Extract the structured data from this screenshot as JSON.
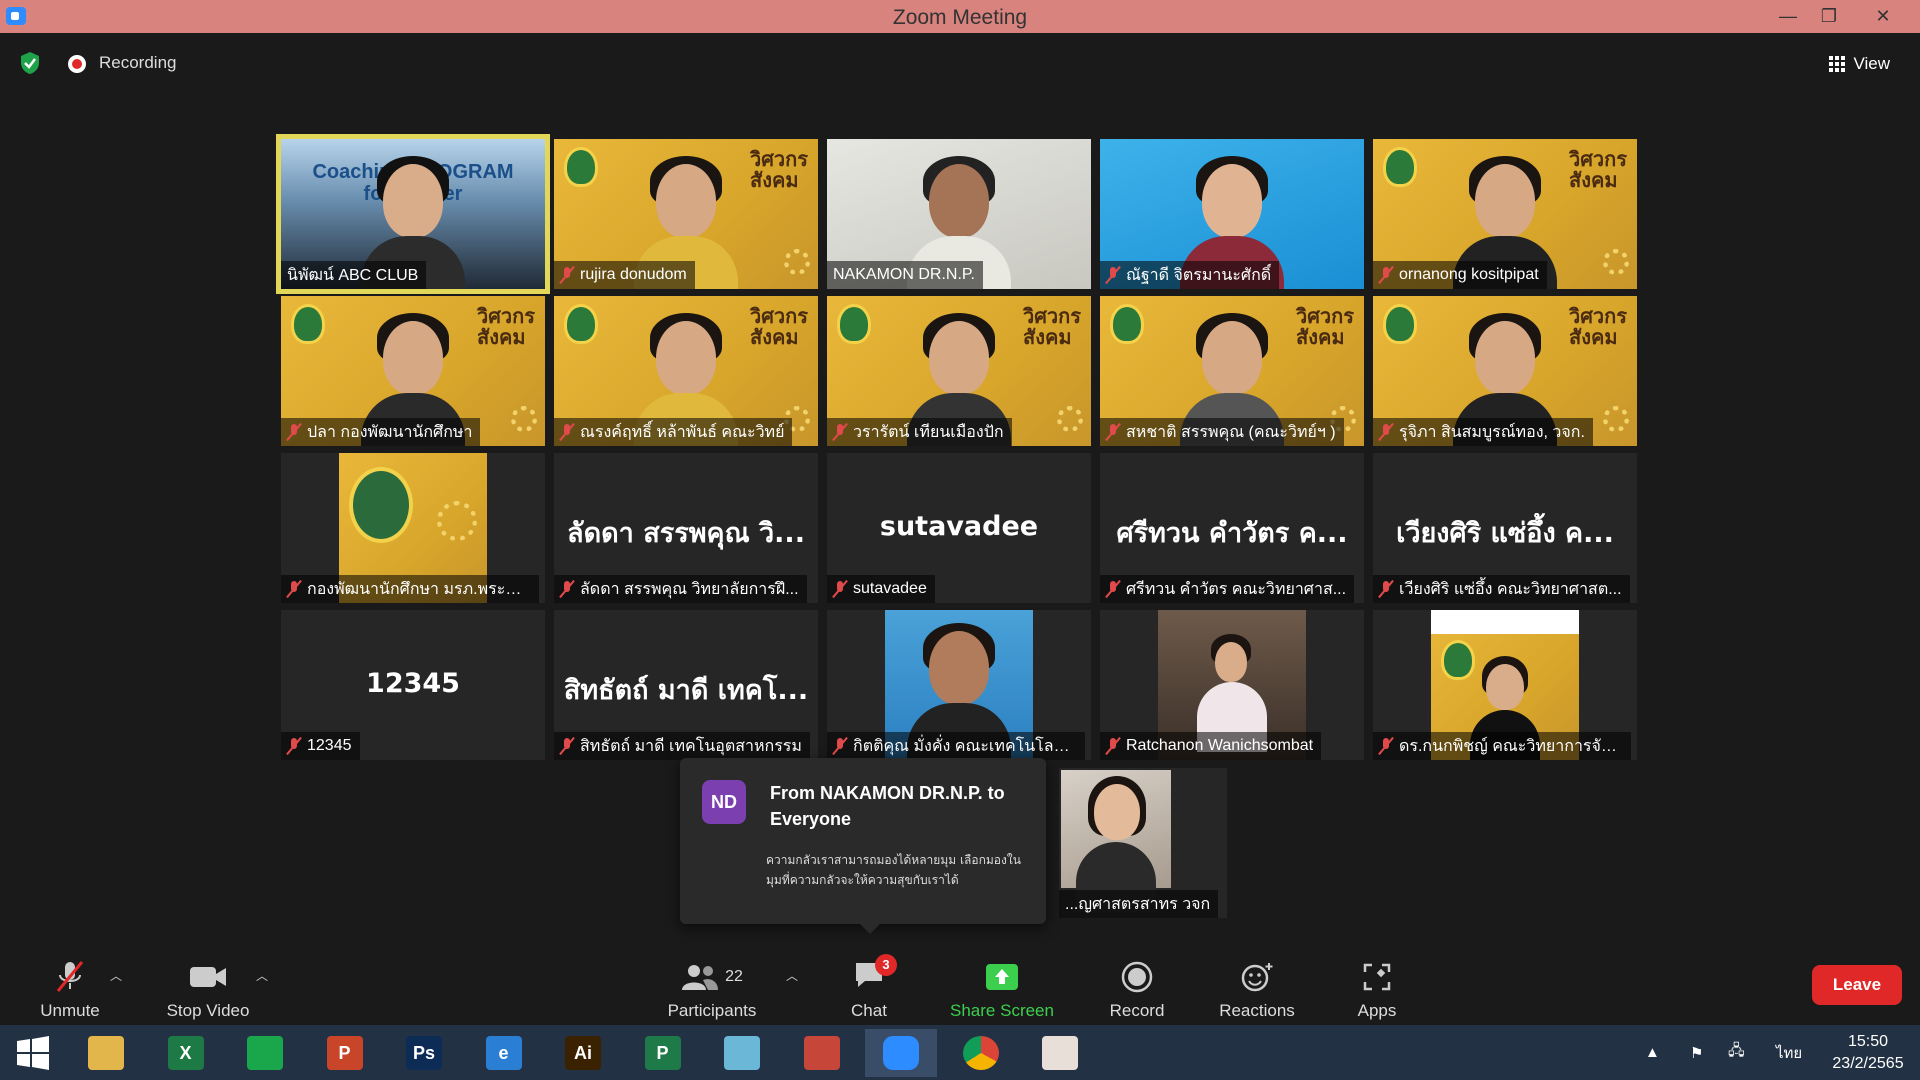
{
  "window": {
    "title": "Zoom Meeting",
    "minimize": "—",
    "restore": "❐",
    "close": "✕"
  },
  "topbar": {
    "recording_label": "Recording",
    "view_label": "View"
  },
  "participants_grid": [
    {
      "name": "นิพัฒน์ ABC CLUB",
      "bg": "coach",
      "active": true,
      "muted": false,
      "overlay_text": "Coaching PROGRAM for Trainer"
    },
    {
      "name": "rujira donudom",
      "bg": "yellow",
      "muted": true
    },
    {
      "name": "NAKAMON DR.N.P.",
      "bg": "white",
      "muted": false
    },
    {
      "name": "ณัฐาดี จิตรมานะศักดิ์",
      "bg": "blue",
      "muted": true
    },
    {
      "name": "ornanong kositpipat",
      "bg": "yellow",
      "muted": true
    },
    {
      "name": "ปลา กองพัฒนานักศึกษา",
      "bg": "yellow",
      "muted": true
    },
    {
      "name": "ณรงค์ฤทธิ์ หล้าพันธ์ คณะวิทย์",
      "bg": "yellow",
      "muted": true
    },
    {
      "name": "วรารัตน์ เทียนเมืองปัก",
      "bg": "yellow",
      "muted": true
    },
    {
      "name": "สหชาติ สรรพคุณ (คณะวิทย์ฯ )",
      "bg": "yellow",
      "muted": true
    },
    {
      "name": "รุจิภา สินสมบูรณ์ทอง, วจก.",
      "bg": "yellow",
      "muted": true
    },
    {
      "name": "กองพัฒนานักศึกษา มรภ.พระนคร",
      "bg": "logo",
      "muted": true
    },
    {
      "name": "ลัดดา สรรพคุณ วิทยาลัยการฝึ...",
      "bg": "text",
      "big": "ลัดดา สรรพคุณ วิ...",
      "muted": true
    },
    {
      "name": "sutavadee",
      "bg": "text",
      "big": "sutavadee",
      "muted": true
    },
    {
      "name": "ศรีทวน คำวัตร คณะวิทยาศาส...",
      "bg": "text",
      "big": "ศรีทวน คำวัตร ค...",
      "muted": true
    },
    {
      "name": "เวียงศิริ แซ่อึ้ง คณะวิทยาศาสต...",
      "bg": "text",
      "big": "เวียงศิริ แซ่อึ้ง ค...",
      "muted": true
    },
    {
      "name": "12345",
      "bg": "text",
      "big": "12345",
      "muted": true
    },
    {
      "name": "สิทธัตถ์ มาดี เทคโนอุตสาหกรรม",
      "bg": "text",
      "big": "สิทธัตถ์ มาดี เทคโ...",
      "muted": true
    },
    {
      "name": "กิตติคุณ มั่งคั่ง คณะเทคโนโลยีอุ...",
      "bg": "avatar",
      "muted": true
    },
    {
      "name": "Ratchanon Wanichsombat",
      "bg": "photo",
      "muted": true
    },
    {
      "name": "ดร.กนกพิชญ์ คณะวิทยาการจัด...",
      "bg": "poster",
      "muted": true
    }
  ],
  "extra_tile": {
    "name": "...ญศาสตรสาทร วจก"
  },
  "brand_text": {
    "line1": "วิศวกร",
    "line2": "สังคม"
  },
  "chat_popup": {
    "avatar_initials": "ND",
    "from": "From NAKAMON DR.N.P. to Everyone",
    "message": "ความกลัวเราสามารถมองได้หลายมุม เลือกมองในมุมที่ความกลัวจะให้ความสุขกับเราได้"
  },
  "toolbar": {
    "unmute": "Unmute",
    "stop_video": "Stop Video",
    "participants_count": "22",
    "participants": "Participants",
    "chat": "Chat",
    "chat_badge": "3",
    "share_screen": "Share Screen",
    "record": "Record",
    "reactions": "Reactions",
    "apps": "Apps",
    "leave": "Leave"
  },
  "taskbar": {
    "apps": [
      {
        "name": "file-explorer",
        "glyph": "",
        "color": "#e2b64a"
      },
      {
        "name": "excel",
        "glyph": "X",
        "color": "#1d7a45"
      },
      {
        "name": "ms-store",
        "glyph": "",
        "color": "#1aa64a"
      },
      {
        "name": "powerpoint",
        "glyph": "P",
        "color": "#c9452a"
      },
      {
        "name": "photoshop",
        "glyph": "Ps",
        "color": "#0c2b55"
      },
      {
        "name": "internet-explorer",
        "glyph": "e",
        "color": "#2a7fd4"
      },
      {
        "name": "illustrator",
        "glyph": "Ai",
        "color": "#3a2200"
      },
      {
        "name": "project",
        "glyph": "P",
        "color": "#1f7a4a"
      },
      {
        "name": "notepad",
        "glyph": "",
        "color": "#6bb7d8"
      },
      {
        "name": "photoscape",
        "glyph": "",
        "color": "#c7463a"
      },
      {
        "name": "zoom",
        "glyph": "",
        "color": "#2d8cff"
      },
      {
        "name": "chrome",
        "glyph": "",
        "color": "#e2b134"
      },
      {
        "name": "photos",
        "glyph": "",
        "color": "#e8e0d8"
      }
    ],
    "tray_lang": "ไทย",
    "time": "15:50",
    "date": "23/2/2565"
  }
}
